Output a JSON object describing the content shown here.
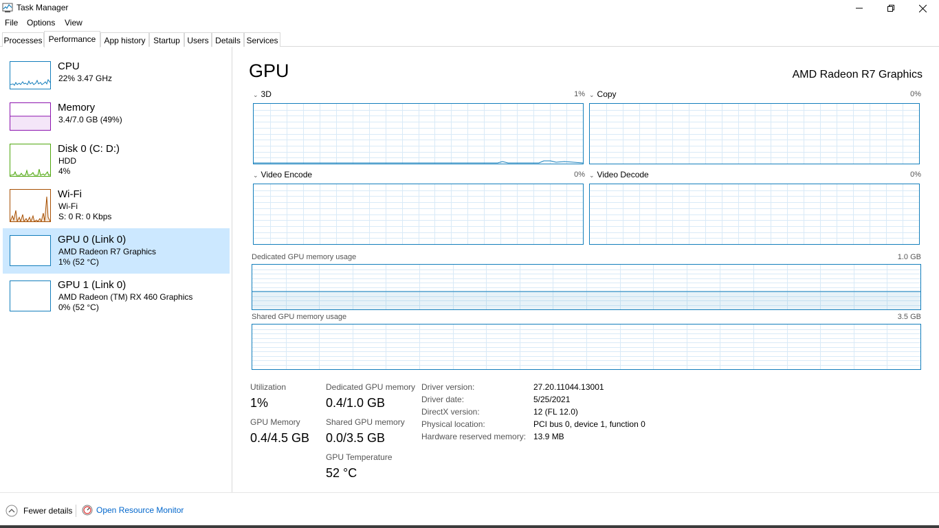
{
  "window": {
    "title": "Task Manager"
  },
  "menu": {
    "items": [
      "File",
      "Options",
      "View"
    ]
  },
  "tabs": [
    "Processes",
    "Performance",
    "App history",
    "Startup",
    "Users",
    "Details",
    "Services"
  ],
  "active_tab": "Performance",
  "sidebar": {
    "items": [
      {
        "title": "CPU",
        "line1": "22% 3.47 GHz",
        "line2": "",
        "color": "#117dbb"
      },
      {
        "title": "Memory",
        "line1": "3.4/7.0 GB (49%)",
        "line2": "",
        "color": "#8b12ae"
      },
      {
        "title": "Disk 0 (C: D:)",
        "line1": "HDD",
        "line2": "4%",
        "color": "#4da60c"
      },
      {
        "title": "Wi-Fi",
        "line1": "Wi-Fi",
        "line2": "S: 0 R: 0 Kbps",
        "color": "#a74f01"
      },
      {
        "title": "GPU 0 (Link 0)",
        "line1": "AMD Radeon R7 Graphics",
        "line2": "1% (52 °C)",
        "color": "#117dbb",
        "selected": true
      },
      {
        "title": "GPU 1 (Link 0)",
        "line1": "AMD Radeon (TM) RX 460 Graphics",
        "line2": "0% (52 °C)",
        "color": "#117dbb"
      }
    ]
  },
  "main": {
    "title": "GPU",
    "model": "AMD Radeon R7 Graphics",
    "engines": [
      {
        "label": "3D",
        "percent": "1%"
      },
      {
        "label": "Copy",
        "percent": "0%"
      },
      {
        "label": "Video Encode",
        "percent": "0%"
      },
      {
        "label": "Video Decode",
        "percent": "0%"
      }
    ],
    "dedicated_mem": {
      "label": "Dedicated GPU memory usage",
      "max": "1.0 GB",
      "fraction": 0.4
    },
    "shared_mem": {
      "label": "Shared GPU memory usage",
      "max": "3.5 GB",
      "fraction": 0.0
    },
    "stats": {
      "utilization": {
        "label": "Utilization",
        "value": "1%"
      },
      "dedicated": {
        "label": "Dedicated GPU memory",
        "value": "0.4/1.0 GB"
      },
      "gpu_memory": {
        "label": "GPU Memory",
        "value": "0.4/4.5 GB"
      },
      "shared": {
        "label": "Shared GPU memory",
        "value": "0.0/3.5 GB"
      },
      "temperature": {
        "label": "GPU Temperature",
        "value": "52 °C"
      }
    },
    "info": [
      {
        "label": "Driver version:",
        "value": "27.20.11044.13001"
      },
      {
        "label": "Driver date:",
        "value": "5/25/2021"
      },
      {
        "label": "DirectX version:",
        "value": "12 (FL 12.0)"
      },
      {
        "label": "Physical location:",
        "value": "PCI bus 0, device 1, function 0"
      },
      {
        "label": "Hardware reserved memory:",
        "value": "13.9 MB"
      }
    ]
  },
  "footer": {
    "fewer_details": "Fewer details",
    "resource_monitor": "Open Resource Monitor"
  },
  "colors": {
    "accent": "#117dbb",
    "grid": "#d9eaf7",
    "selected": "#cce8ff",
    "link": "#0066cc"
  }
}
